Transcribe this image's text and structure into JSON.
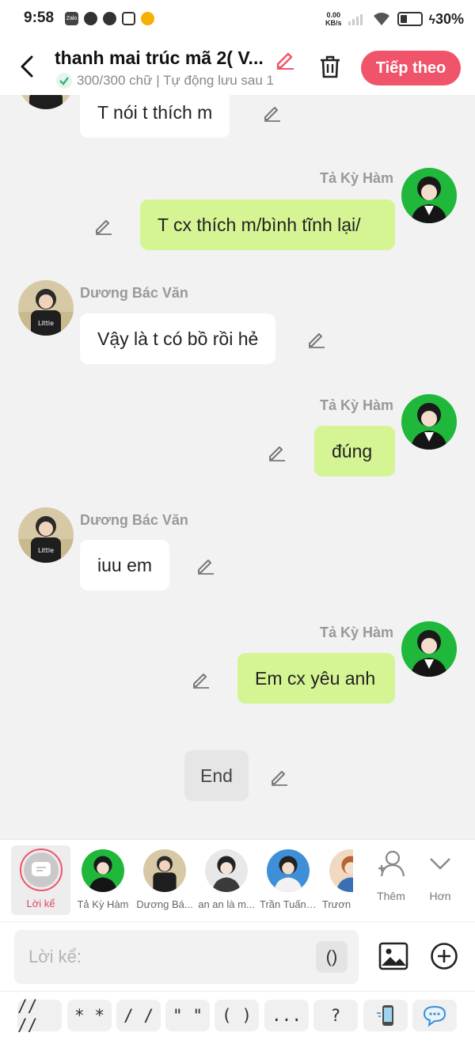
{
  "status_bar": {
    "time": "9:58",
    "app_icons": [
      "zalo-icon",
      "messenger-icon",
      "facebook-icon",
      "copy-icon",
      "weibo-icon"
    ],
    "zalo_text": "Zalo",
    "speed_value": "0.00",
    "speed_unit": "KB/s",
    "battery": "30%"
  },
  "header": {
    "title": "thanh mai trúc mã 2( V...",
    "subtitle": "300/300 chữ | Tự động lưu sau 1",
    "next_button": "Tiếp theo"
  },
  "messages": [
    {
      "side": "left",
      "name": "",
      "text": "T nói t thích m"
    },
    {
      "side": "right",
      "name": "Tả Kỳ Hàm",
      "text": "T cx thích m/bình tĩnh lại/"
    },
    {
      "side": "left",
      "name": "Dương Bác Văn",
      "text": "Vậy là t có bồ rồi hẻ"
    },
    {
      "side": "right",
      "name": "Tả Kỳ Hàm",
      "text": "đúng"
    },
    {
      "side": "left",
      "name": "Dương Bác Văn",
      "text": "iuu em"
    },
    {
      "side": "right",
      "name": "Tả Kỳ Hàm",
      "text": "Em cx yêu anh"
    },
    {
      "side": "center",
      "name": "",
      "text": "End"
    }
  ],
  "characters": {
    "narrator": "Lời kể",
    "items": [
      "Tả Kỳ Hàm",
      "Dương Bá...",
      "an an là m...",
      "Trần Tuấn ...",
      "Trươn"
    ],
    "add_label": "Thêm",
    "more_label": "Hơn"
  },
  "composer": {
    "placeholder": "Lời kể:",
    "paren_button": "()"
  },
  "quick_symbols": [
    "// //",
    "* *",
    "/ /",
    "\" \"",
    "( )",
    "...",
    "?"
  ],
  "colors": {
    "accent": "#f0546b",
    "green_bubble": "#d5f594",
    "background": "#f2f2f2"
  }
}
